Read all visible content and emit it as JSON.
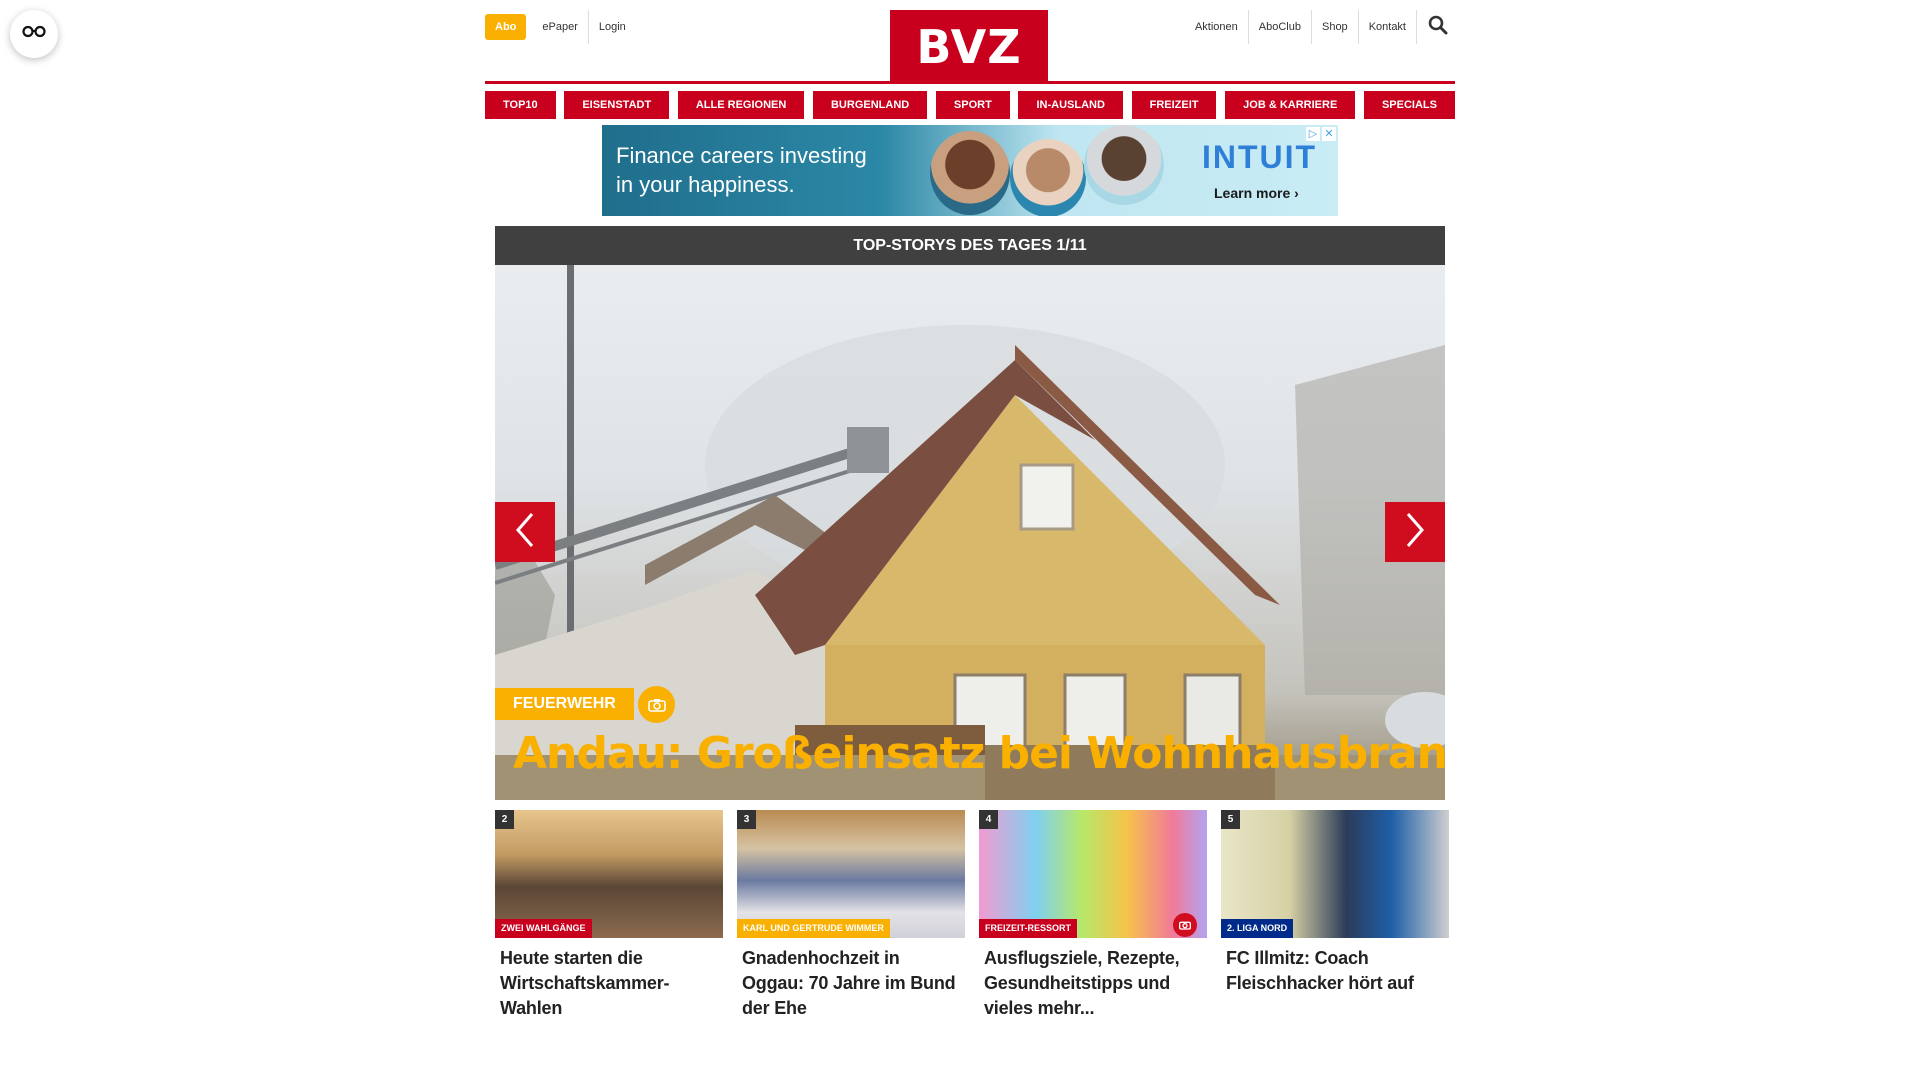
{
  "reader_button": {
    "icon": "glasses-icon"
  },
  "header": {
    "abo_label": "Abo",
    "left_links": [
      "ePaper",
      "Login"
    ],
    "logo_text": "BVZ",
    "right_links": [
      "Aktionen",
      "AboClub",
      "Shop",
      "Kontakt"
    ],
    "search_icon": "search-icon"
  },
  "nav": {
    "items": [
      "TOP10",
      "EISENSTADT",
      "ALLE REGIONEN",
      "BURGENLAND",
      "SPORT",
      "IN-AUSLAND",
      "FREIZEIT",
      "JOB & KARRIERE",
      "SPECIALS"
    ]
  },
  "ad": {
    "text_line1": "Finance careers investing",
    "text_line2": "in your happiness.",
    "brand": "INTUIT",
    "cta": "Learn more ›",
    "icons": [
      "adchoices-icon",
      "close-icon"
    ]
  },
  "top_stories": {
    "bar_title": "TOP-STORYS DES TAGES 1/11",
    "hero": {
      "tag": "FEUERWEHR",
      "title": "Andau: Großeinsatz bei Wohnhausbrand",
      "has_gallery_icon": true
    },
    "prev_icon": "chevron-left-icon",
    "next_icon": "chevron-right-icon"
  },
  "cards": [
    {
      "number": "2",
      "tag": "ZWEI WAHLGÄNGE",
      "tag_color": "#c8001e",
      "title": "Heute starten die Wirtschaftskammer-Wahlen",
      "camera": false
    },
    {
      "number": "3",
      "tag": "KARL UND GERTRUDE WIMMER",
      "tag_color": "#f9b000",
      "title": "Gnadenhochzeit in Oggau: 70 Jahre im Bund der Ehe",
      "camera": false
    },
    {
      "number": "4",
      "tag": "FREIZEIT-RESSORT",
      "tag_color": "#c8001e",
      "title": "Ausflugsziele, Rezepte, Gesundheitstipps und vieles mehr...",
      "camera": true
    },
    {
      "number": "5",
      "tag": "2. LIGA NORD",
      "tag_color": "#002b8a",
      "title": "FC Illmitz: Coach Fleischhacker hört auf",
      "camera": false
    }
  ],
  "colors": {
    "brand_red": "#c8001e",
    "accent_yellow": "#f9b000",
    "bar_dark": "#404040"
  }
}
